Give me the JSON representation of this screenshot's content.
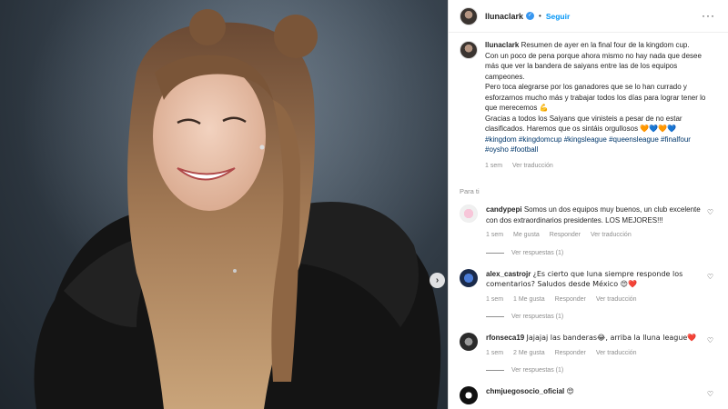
{
  "post": {
    "username": "llunaclark",
    "follow_label": "Seguir",
    "more_label": "···",
    "next_label": "›"
  },
  "caption": {
    "username": "llunaclark",
    "lines": [
      "Resumen de ayer en la final four de la kingdom cup.",
      "Con un poco de pena porque ahora mismo no hay nada que desee más que ver la bandera de saiyans entre las de los equipos campeones.",
      "Pero toca alegrarse por los ganadores que se lo han currado y esforzarnos mucho más y trabajar todos los días para lograr tener lo que merecemos 💪",
      "Gracias a todos los Saiyans que vinisteis a pesar de no estar clasificados. Haremos que os sintáis orgullosos 🧡💙🧡💙"
    ],
    "hashtags": "#kingdom #kingdomcup #kingsleague #queensleague #finalfour #oysho #football",
    "time": "1 sem",
    "translate": "Ver traducción"
  },
  "for_you_label": "Para ti",
  "comments": [
    {
      "username": "candypepi",
      "text": "Somos un dos equipos muy buenos, un club excelente con dos extraordinarios presidentes. LOS MEJORES!!!",
      "time": "1 sem",
      "likes": "Me gusta",
      "reply": "Responder",
      "translate": "Ver traducción",
      "replies": "Ver respuestas (1)"
    },
    {
      "username": "alex_castrojr",
      "text": "¿Es cierto que luna siempre responde los comentarios? Saludos desde México 😍❤️",
      "time": "1 sem",
      "likes": "1 Me gusta",
      "reply": "Responder",
      "translate": "Ver traducción",
      "replies": "Ver respuestas (1)"
    },
    {
      "username": "rfonseca19",
      "text": "Jajajaj las banderas😂, arriba la lluna league❤️",
      "time": "1 sem",
      "likes": "2 Me gusta",
      "reply": "Responder",
      "translate": "Ver traducción",
      "replies": "Ver respuestas (1)"
    },
    {
      "username": "chmjuegosocio_oficial",
      "text": "😍",
      "time": "",
      "likes": "",
      "reply": "",
      "translate": "",
      "replies": ""
    }
  ],
  "icons": {
    "verified": "verified-badge-icon",
    "heart": "heart-icon",
    "more": "more-options-icon",
    "next": "chevron-right-icon"
  },
  "colors": {
    "link": "#0095f6",
    "hashtag": "#00376b",
    "muted": "#8e8e8e"
  }
}
